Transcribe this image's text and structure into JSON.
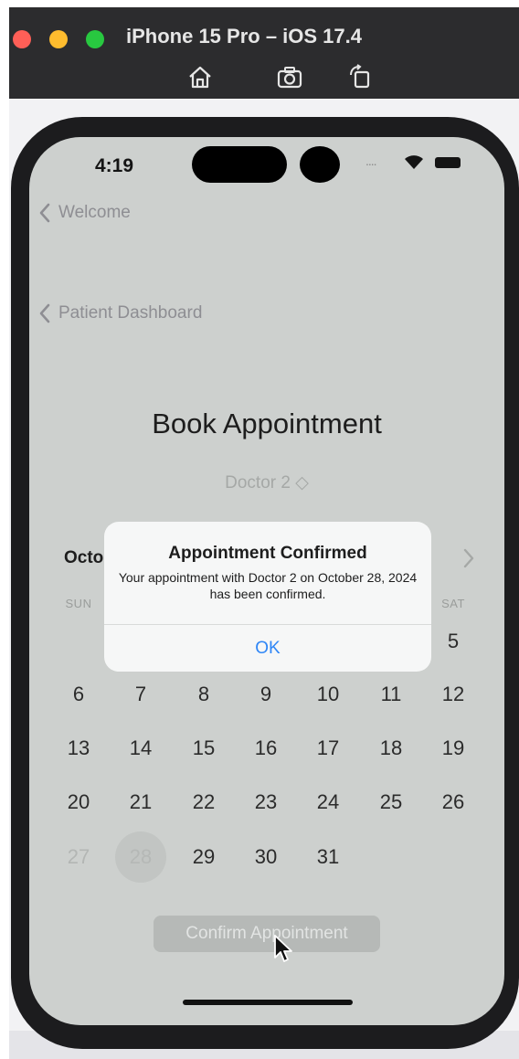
{
  "simulator": {
    "title": "iPhone 15 Pro – iOS 17.4",
    "icons": [
      "home-icon",
      "screenshot-icon",
      "rotate-icon"
    ]
  },
  "status_bar": {
    "time": "4:19",
    "signal_dots": "....",
    "icons": [
      "wifi-icon",
      "battery-icon"
    ]
  },
  "nav": {
    "back_welcome": "Welcome",
    "back_dashboard": "Patient Dashboard"
  },
  "page": {
    "title": "Book Appointment",
    "doctor_picker": "Doctor 2 ◇"
  },
  "calendar": {
    "month_label": "Octo",
    "weekdays": {
      "sun": "SUN",
      "sat": "SAT"
    },
    "days": {
      "d5": "5",
      "d6": "6",
      "d7": "7",
      "d8": "8",
      "d9": "9",
      "d10": "10",
      "d11": "11",
      "d12": "12",
      "d13": "13",
      "d14": "14",
      "d15": "15",
      "d16": "16",
      "d17": "17",
      "d18": "18",
      "d19": "19",
      "d20": "20",
      "d21": "21",
      "d22": "22",
      "d23": "23",
      "d24": "24",
      "d25": "25",
      "d26": "26",
      "d27": "27",
      "d28": "28",
      "d29": "29",
      "d30": "30",
      "d31": "31"
    },
    "selected_day": "28"
  },
  "confirm_button": "Confirm Appointment",
  "alert": {
    "title": "Appointment Confirmed",
    "message": "Your appointment with Doctor 2 on October 28, 2024 has been confirmed.",
    "ok_label": "OK"
  },
  "colors": {
    "accent": "#2f86f6",
    "screen_dimmed": "#cdd0ce",
    "close": "#ff5f57",
    "minimize": "#febc2e",
    "maximize": "#28c840"
  }
}
